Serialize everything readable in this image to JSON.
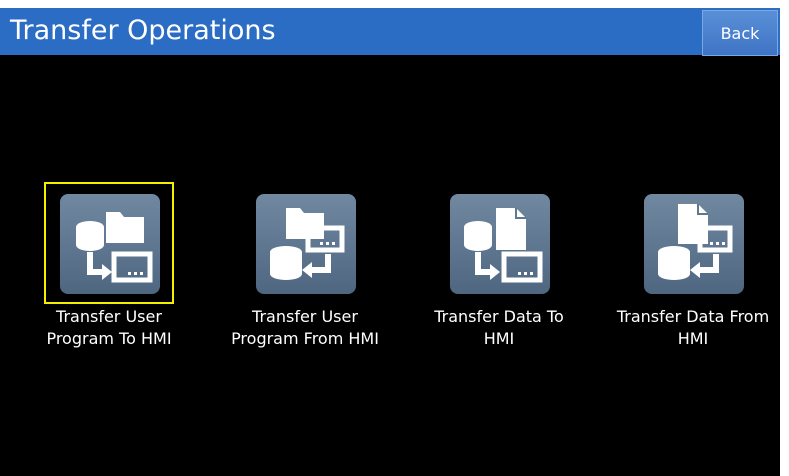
{
  "window": {
    "title": "Transfer Operations",
    "back_label": "Back"
  },
  "tiles": [
    {
      "line1": "Transfer User",
      "line2": "Program To HMI",
      "icon": "transfer-to-hmi-program-icon",
      "selected": true
    },
    {
      "line1": "Transfer User",
      "line2": "Program From HMI",
      "icon": "transfer-from-hmi-program-icon",
      "selected": false
    },
    {
      "line1": "Transfer Data To",
      "line2": "HMI",
      "icon": "transfer-to-hmi-data-icon",
      "selected": false
    },
    {
      "line1": "Transfer Data From",
      "line2": "HMI",
      "icon": "transfer-from-hmi-data-icon",
      "selected": false
    }
  ],
  "colors": {
    "header": "#2b6cc4",
    "background": "#000000",
    "selection": "#f2f000",
    "tile": "#5f7891"
  }
}
